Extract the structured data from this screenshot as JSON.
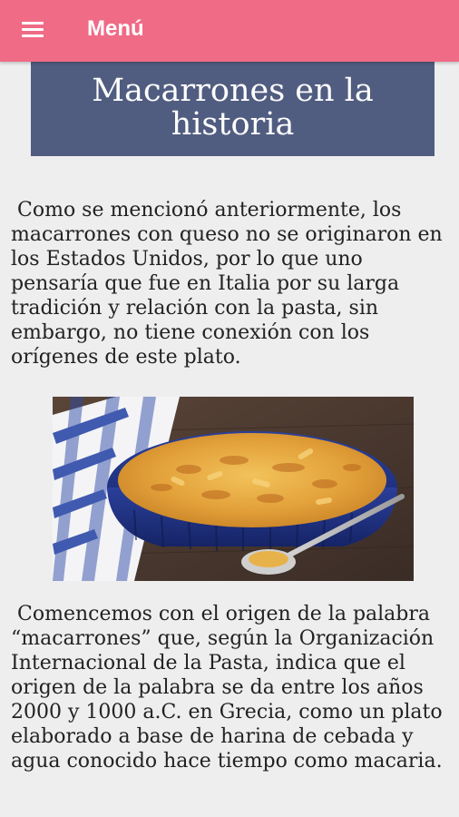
{
  "appbar": {
    "menu_label": "Menú",
    "menu_icon": "hamburger-icon",
    "color": "#f06b86"
  },
  "article": {
    "title": "Macarrones en la historia",
    "title_bg": "#515d80",
    "paragraph_1": " Como se mencionó anteriormente, los macarrones con queso no se originaron en los Estados Unidos, por lo que uno pensaría que fue en Italia por su larga tradición y relación con la pasta, sin embargo, no tiene conexión con los orígenes de este plato.",
    "paragraph_2": " Comencemos con el origen de la palabra “macarrones” que, según la Organización Internacional de la Pasta, indica que el origen de la palabra se da entre los años 2000 y 1000 a.C. en Grecia, como un plato elaborado a base de harina de cebada y agua conocido hace tiempo como macaria."
  }
}
